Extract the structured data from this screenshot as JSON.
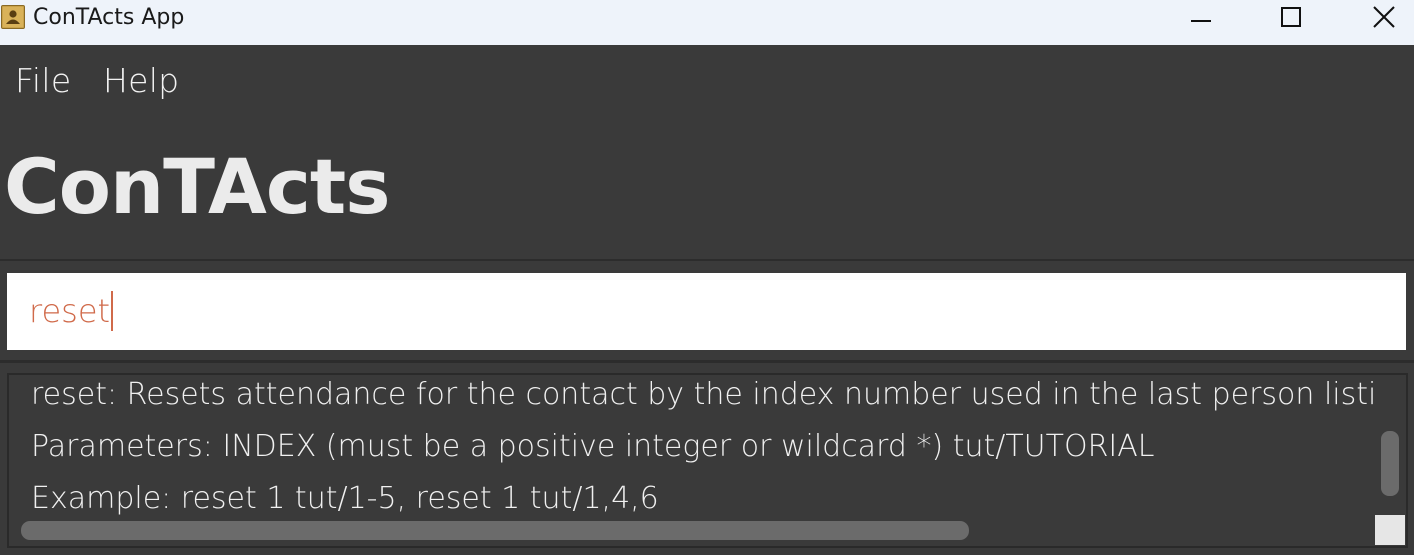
{
  "window": {
    "title": "ConTActs App",
    "app_icon": "contact-book-icon",
    "controls": {
      "minimize_icon": "minimize-icon",
      "maximize_icon": "maximize-icon",
      "close_icon": "close-icon"
    }
  },
  "menu": {
    "items": [
      {
        "label": "File"
      },
      {
        "label": "Help"
      }
    ]
  },
  "header": {
    "title": "ConTActs"
  },
  "command_box": {
    "value": "reset"
  },
  "result_display": {
    "lines": [
      "reset: Resets attendance for the contact by the index number used in the last person listing ar",
      "Parameters: INDEX (must be a positive integer or wildcard *) tut/TUTORIAL",
      "Example: reset 1 tut/1-5, reset 1 tut/1,4,6"
    ]
  },
  "colors": {
    "background": "#3a3a3a",
    "titlebar": "#eef3fa",
    "command_text": "#d06a4a",
    "text": "#f0f0f0",
    "scrollbar": "#6b6b6b"
  }
}
